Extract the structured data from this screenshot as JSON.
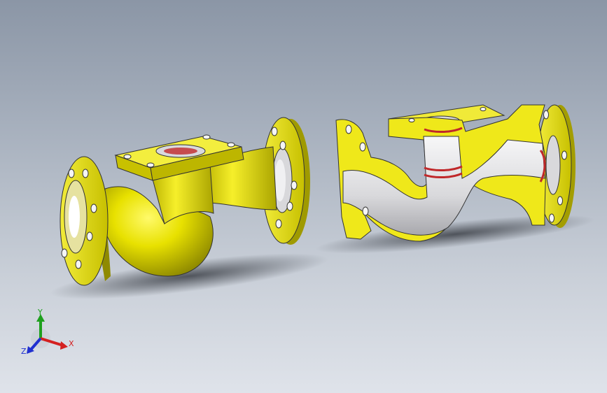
{
  "viewport": {
    "background_top": "#8b96a6",
    "background_bottom": "#dfe3ea"
  },
  "model": {
    "part_color": "#e8e100",
    "part_shadow": "#a49e00",
    "interior_color": "#e9e9ea",
    "seal_color": "#c0282a"
  },
  "triad": {
    "x_label": "X",
    "y_label": "Y",
    "z_label": "Z",
    "x_color": "#d42020",
    "y_color": "#1ea01e",
    "z_color": "#2030d0"
  }
}
